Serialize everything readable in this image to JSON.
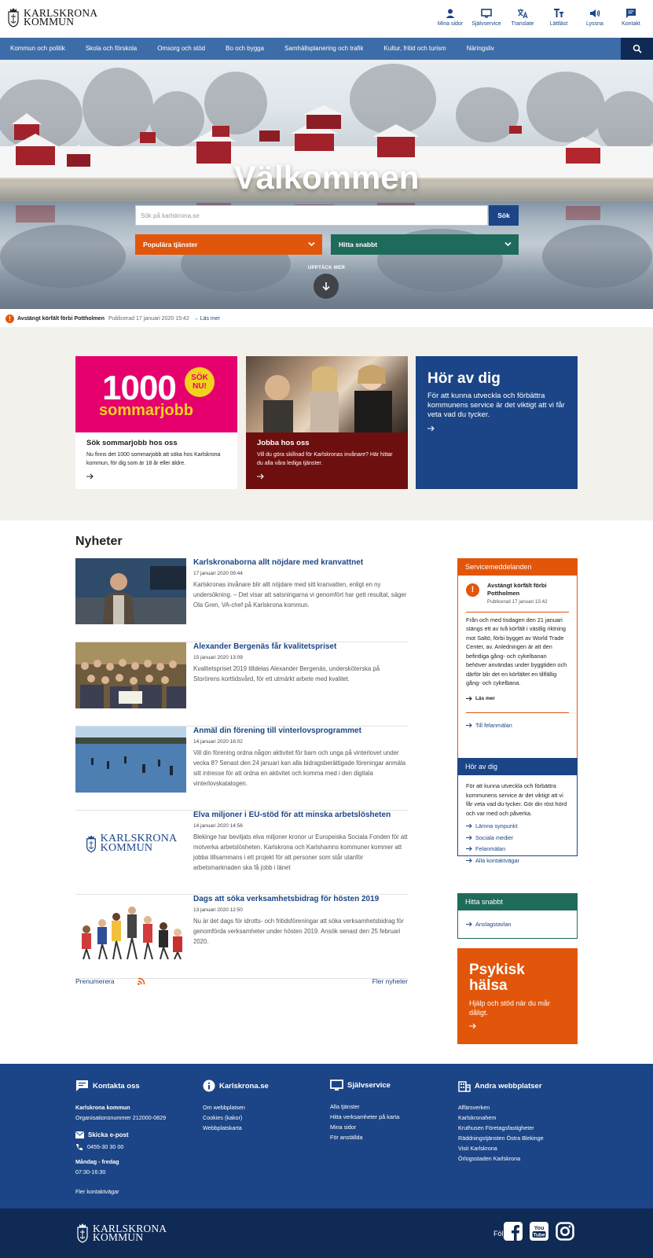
{
  "header": {
    "logo_line1": "KARLSKRONA",
    "logo_line2": "KOMMUN",
    "tools": [
      {
        "icon": "user-icon",
        "label": "Mina sidor"
      },
      {
        "icon": "monitor-icon",
        "label": "Självservice"
      },
      {
        "icon": "translate-icon",
        "label": "Translate"
      },
      {
        "icon": "text-size-icon",
        "label": "Lättläst"
      },
      {
        "icon": "speaker-icon",
        "label": "Lyssna"
      },
      {
        "icon": "chat-icon",
        "label": "Kontakt"
      }
    ]
  },
  "nav": {
    "items": [
      "Kommun och politik",
      "Skola och förskola",
      "Omsorg och stöd",
      "Bo och bygga",
      "Samhällsplanering och trafik",
      "Kultur, fritid och turism",
      "Näringsliv"
    ]
  },
  "hero": {
    "title": "Välkommen",
    "search_placeholder": "Sök på karlskrona.se",
    "search_button": "Sök",
    "dropdown1": "Populära tjänster",
    "dropdown2": "Hitta snabbt",
    "discover": "UPPTÄCK MER"
  },
  "alert": {
    "title": "Avstängt körfält förbi Pottholmen",
    "published": "Publicerad 17 januari 2020 15:42",
    "link": "Läs mer"
  },
  "promo": {
    "card1": {
      "big": "1000",
      "sub": "sommarjobb",
      "badge1": "SÖK",
      "badge2": "NU!",
      "title": "Sök sommarjobb hos oss",
      "text": "Nu finns det 1000 sommarjobb att söka hos Karlskrona kommun, för dig som är 18 år eller äldre."
    },
    "card2": {
      "title": "Jobba hos oss",
      "text": "Vill du göra skillnad för Karlskronas invånare? Här hittar du alla våra lediga tjänster."
    },
    "card3": {
      "title": "Hör av dig",
      "text": "För att kunna utveckla och förbättra kommunens service är det viktigt att vi får veta vad du tycker."
    }
  },
  "news": {
    "heading": "Nyheter",
    "items": [
      {
        "title": "Karlskronaborna allt nöjdare med kranvattnet",
        "date": "17 januari 2020 09:44",
        "text": "Karlskronas invånare blir allt nöjdare med sitt kranvatten, enligt en ny undersökning. – Det visar att satsningarna vi genomfört har gett resultat, säger Ola Gren, VA-chef på Karlskrona kommun."
      },
      {
        "title": "Alexander Bergenäs får kvalitetspriset",
        "date": "15 januari 2020 13:09",
        "text": "Kvalitetspriset 2019 tilldelas Alexander Bergenäs, undersköterska på Storörens korttidsvård, för ett utmärkt arbete med kvalitet."
      },
      {
        "title": "Anmäl din förening till vinterlovsprogrammet",
        "date": "14 januari 2020 16:02",
        "text": "Vill din förening ordna någon aktivitet för barn och unga på vinterlovet under vecka 8? Senast den 24 januari kan alla bidragsberättigade föreningar anmäla sitt intresse för att ordna en aktivitet och komma med i den digitala vinterlovskatalogen."
      },
      {
        "title": "Elva miljoner i EU-stöd för att minska arbetslösheten",
        "date": "14 januari 2020 14:56",
        "text": "Blekinge har beviljats elva miljoner kronor ur Europeiska Sociala Fonden för att motverka arbetslösheten. Karlskrona och Karlshamns kommuner kommer att jobba tillsammans i ett projekt för att personer som står utanför arbetsmarknaden ska få jobb i länet"
      },
      {
        "title": "Dags att söka verksamhetsbidrag för hösten 2019",
        "date": "13 januari 2020 12:50",
        "text": "Nu är det dags för idrotts- och fritidsföreningar att söka verksamhetsbidrag för genomförda verksamheter under hösten 2019. Ansök senast den 25 februari 2020."
      }
    ],
    "subscribe": "Prenumerera",
    "more": "Fler nyheter"
  },
  "sidebar": {
    "service": {
      "title": "Servicemeddelanden",
      "alert_title": "Avstängt körfält förbi Pottholmen",
      "alert_date": "Publicerad 17 januari 15:42",
      "text": "Från och med tisdagen den 21 januari stängs ett av två körfält i västlig riktning mot Saltö, förbi bygget av World Trade Center, av. Anledningen är att den befintliga gång- och cykelbanan behöver användas under byggtiden och därför blir det en körfältet en tillfällig gång- och cykelbana.",
      "read_more": "Läs mer",
      "report": "Till felanmälan"
    },
    "contact": {
      "title": "Hör av dig",
      "text": "För att kunna utveckla och förbättra kommunens service är det viktigt att vi får veta vad du tycker. Gör din röst hörd och var med och påverka.",
      "links": [
        "Lämna synpunkt",
        "Sociala medier",
        "Felanmälan",
        "Alla kontaktvägar"
      ]
    },
    "quick": {
      "title": "Hitta snabbt",
      "links": [
        "Anslagstavlan"
      ]
    },
    "psyk": {
      "title1": "Psykisk",
      "title2": "hälsa",
      "text": "Hjälp och stöd när du mår dåligt."
    }
  },
  "footer": {
    "contact": {
      "title": "Kontakta oss",
      "org": "Karlskrona kommun",
      "orgnr": "Organisationsnummer 212000-0829",
      "email": "Skicka e-post",
      "phone": "0455-30 30 00",
      "hours_label": "Måndag - fredag",
      "hours": "07:30-16:30",
      "more": "Fler kontaktvägar"
    },
    "site": {
      "title": "Karlskrona.se",
      "links": [
        "Om webbplatsen",
        "Cookies (kakor)",
        "Webbplatskarta"
      ]
    },
    "self": {
      "title": "Självservice",
      "links": [
        "Alla tjänster",
        "Hitta verksamheter på karta",
        "Mina sidor",
        "För anställda"
      ]
    },
    "other": {
      "title": "Andra webbplatser",
      "links": [
        "Affärsverken",
        "Karlskronahem",
        "Kruthusen Företagsfastigheter",
        "Räddningstjänsten Östra Blekinge",
        "Visit Karlskrona",
        "Örlogsstaden Karlskrona"
      ]
    }
  },
  "bottom": {
    "logo_line1": "KARLSKRONA",
    "logo_line2": "KOMMUN",
    "follow": "Följ oss"
  }
}
